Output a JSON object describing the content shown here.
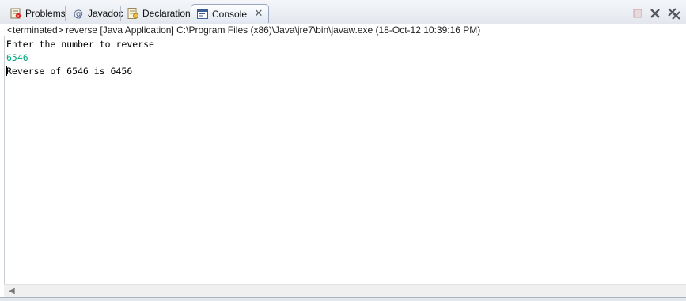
{
  "tabs": [
    {
      "label": "Problems",
      "icon": "problems-icon",
      "active": false
    },
    {
      "label": "Javadoc",
      "icon": "at-icon",
      "active": false
    },
    {
      "label": "Declaration",
      "icon": "declaration-icon",
      "active": false
    },
    {
      "label": "Console",
      "icon": "console-icon",
      "active": true
    }
  ],
  "toolbar": {
    "terminate_icon": "terminate-icon",
    "remove_launch_icon": "remove-launch-icon",
    "remove_all_icon": "remove-all-terminated-icon"
  },
  "console": {
    "status": "<terminated> reverse [Java Application] C:\\Program Files (x86)\\Java\\jre7\\bin\\javaw.exe (18-Oct-12 10:39:16 PM)",
    "lines": [
      {
        "text": "Enter the number to reverse",
        "color": "#000000"
      },
      {
        "text": "6546",
        "color": "#00a87a"
      },
      {
        "text": "Reverse of 6546 is 6456",
        "color": "#000000"
      }
    ]
  },
  "colors": {
    "input_text": "#00a87a",
    "active_tab_border": "#97a8c0",
    "tabbar_bg": "#e3e7ed"
  }
}
